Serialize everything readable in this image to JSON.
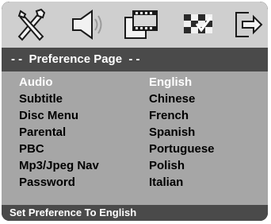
{
  "toolbar": {
    "icons": [
      "tools-icon",
      "speaker-icon",
      "film-icon",
      "preference-checkerboard-icon",
      "exit-icon"
    ]
  },
  "header": {
    "title": "- -  Preference Page  - -"
  },
  "menu": {
    "items": [
      {
        "label": "Audio",
        "value": "English",
        "selected": true
      },
      {
        "label": "Subtitle",
        "value": "Chinese",
        "selected": false
      },
      {
        "label": "Disc Menu",
        "value": "French",
        "selected": false
      },
      {
        "label": "Parental",
        "value": "Spanish",
        "selected": false
      },
      {
        "label": "PBC",
        "value": "Portuguese",
        "selected": false
      },
      {
        "label": "Mp3/Jpeg Nav",
        "value": "Polish",
        "selected": false
      },
      {
        "label": "Password",
        "value": "Italian",
        "selected": false
      }
    ]
  },
  "footer": {
    "status": "Set Preference To English"
  },
  "colors": {
    "background": "#000000",
    "iconbar": "#cfcfcf",
    "header": "#4a4a4a",
    "content": "#a6a6a6",
    "selected_text": "#ffffff",
    "text": "#000000"
  }
}
